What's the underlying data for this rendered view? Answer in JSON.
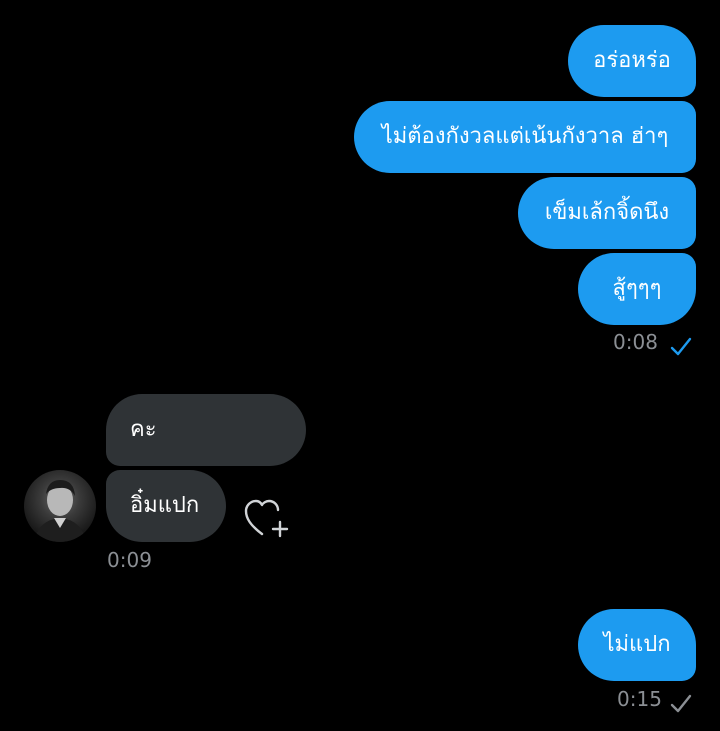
{
  "conversation": {
    "outgoing_group_1": {
      "messages": [
        "อร่อหร่อ",
        "ไม่ต้องกังวลแต่เน้นกังวาล ฮ่าๆ",
        "เข็มเล้กจิ้ดนึง",
        "สู้ๆๆๆ"
      ],
      "time": "0:08",
      "status_icon": "read-check-icon",
      "status_color": "#1d9bf0"
    },
    "incoming_group": {
      "messages": [
        "คะ",
        "อิ๋มแปก"
      ],
      "time": "0:09",
      "avatar_icon": "avatar",
      "reaction_icon": "add-reaction-heart-icon"
    },
    "outgoing_group_2": {
      "messages": [
        "ไม่แปก"
      ],
      "time": "0:15",
      "status_icon": "sent-check-icon",
      "status_color": "#8b8f94"
    }
  },
  "colors": {
    "background": "#000000",
    "outgoing_bubble": "#1d9bf0",
    "incoming_bubble": "#2f3336",
    "timestamp": "#8b8f94"
  }
}
